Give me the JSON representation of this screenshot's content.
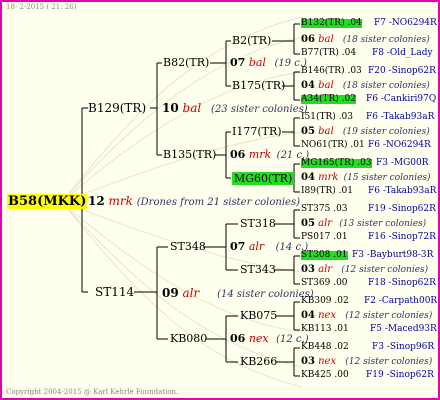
{
  "header": "18-  2-2015 ( 21: 26)",
  "footer": "Copyright 2004-2015 @ Karl Kehrle Foundation.",
  "root": "B58(MKK)",
  "gen1": {
    "num": "12",
    "name": "mrk",
    "note": "(Drones from 21 sister colonies)",
    "top": "B129(TR)",
    "bottom": "ST114"
  },
  "gen2_top": {
    "num": "10",
    "name": "bal",
    "note": "(23 sister colonies)",
    "top": "B82(TR)",
    "bottom": "B135(TR)"
  },
  "gen2_bottom": {
    "num": "09",
    "name": "alr",
    "note": "(14 sister colonies)",
    "top": "ST348",
    "bottom": "KB080"
  },
  "g3": [
    {
      "num": "07",
      "name": "bal",
      "note": "(19 c.)",
      "top": "B2(TR)",
      "bottom": "B175(TR)"
    },
    {
      "num": "06",
      "name": "mrk",
      "note": "(21 c.)",
      "top": "I177(TR)",
      "bottom": "MG60(TR)"
    },
    {
      "num": "07",
      "name": "alr",
      "note": "(14 c.)",
      "top": "ST318",
      "bottom": "ST343"
    },
    {
      "num": "06",
      "name": "nex",
      "note": "(12 c.)",
      "top": "KB075",
      "bottom": "KB266"
    }
  ],
  "g4": [
    {
      "a": "B132(TR) .04",
      "a_info": "F7 -NO6294R",
      "num": "06",
      "name": "bal",
      "note": "(18 sister colonies)",
      "b": "B77(TR) .04",
      "b_info": "F8 -Old_Lady"
    },
    {
      "a": "B146(TR) .03",
      "a_info": "F20 -Sinop62R",
      "num": "04",
      "name": "bal",
      "note": "(18 sister colonies)",
      "b": "A34(TR) .02",
      "b_info": "F6 -Cankiri97Q"
    },
    {
      "a": "I51(TR) .03",
      "a_info": "F6 -Takab93aR",
      "num": "05",
      "name": "bal",
      "note": "(19 sister colonies)",
      "b": "NO61(TR) .01",
      "b_info": "F6 -NO6294R"
    },
    {
      "a": "MG165(TR) .03",
      "a_info": "F3 -MG00R",
      "num": "04",
      "name": "mrk",
      "note": "(15 sister colonies)",
      "b": "I89(TR) .01",
      "b_info": "F6 -Takab93aR"
    },
    {
      "a": "ST375 .03",
      "a_info": "F19 -Sinop62R",
      "num": "05",
      "name": "alr",
      "note": "(13 sister colonies)",
      "b": "PS017 .01",
      "b_info": "F16 -Sinop72R"
    },
    {
      "a": "ST308 .01",
      "a_info": "F3 -Bayburt98-3R",
      "num": "03",
      "name": "alr",
      "note": "(12 sister colonies)",
      "b": "ST369 .00",
      "b_info": "F18 -Sinop62R"
    },
    {
      "a": "KB309 .02",
      "a_info": "F2 -Carpath00R",
      "num": "04",
      "name": "nex",
      "note": "(12 sister colonies)",
      "b": "KB113 .01",
      "b_info": "F5 -Maced93R"
    },
    {
      "a": "KB448 .02",
      "a_info": "F3 -Sinop96R",
      "num": "03",
      "name": "nex",
      "note": "(12 sister colonies)",
      "b": "KB425 .00",
      "b_info": "F19 -Sinop62R"
    }
  ],
  "colors": {
    "frame": "#e600b4",
    "background": "#ffffee",
    "highlight": "#22dd22",
    "root_bg": "#ffff00",
    "line": "#000000"
  }
}
